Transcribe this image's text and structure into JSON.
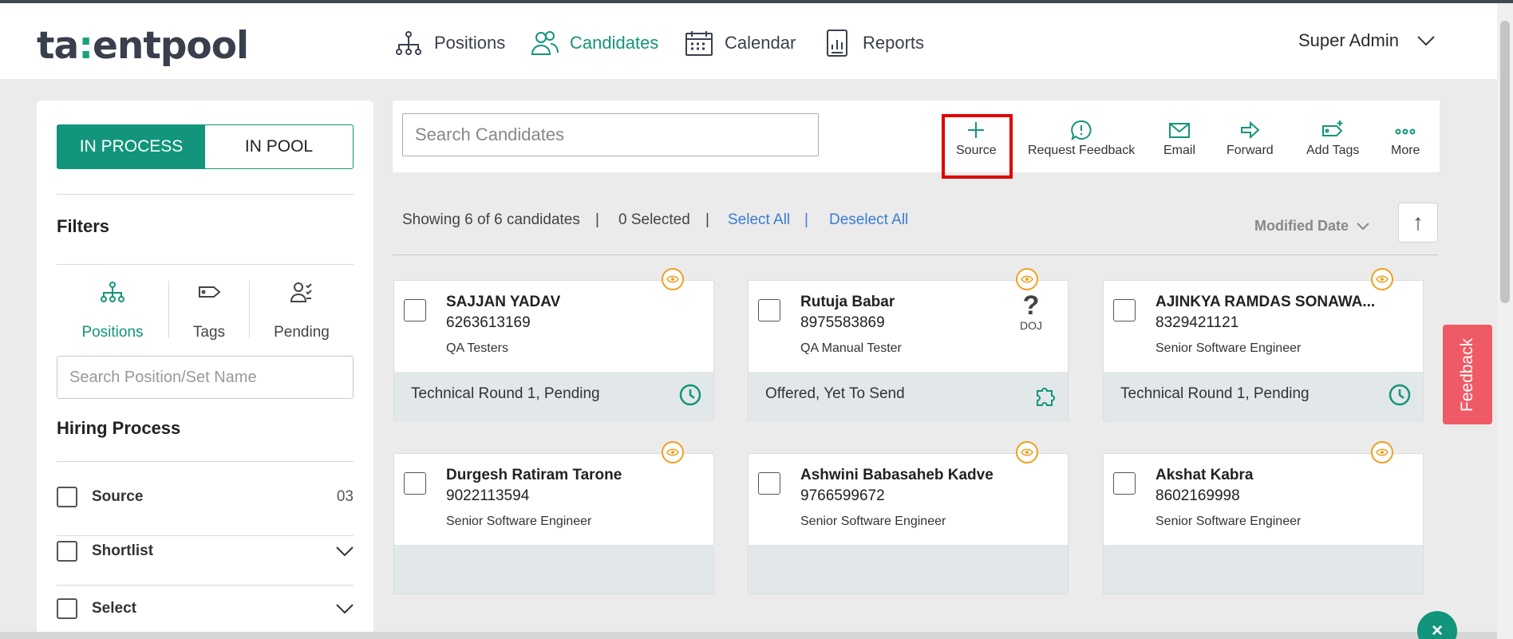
{
  "app": {
    "logo_pre": "ta",
    "logo_accent": ":",
    "logo_post": "entpool"
  },
  "nav": {
    "positions": "Positions",
    "candidates": "Candidates",
    "calendar": "Calendar",
    "reports": "Reports"
  },
  "user": {
    "name": "Super Admin"
  },
  "sidebar": {
    "toggle_in_process": "IN PROCESS",
    "toggle_in_pool": "IN POOL",
    "filters_title": "Filters",
    "tab_positions": "Positions",
    "tab_tags": "Tags",
    "tab_pending": "Pending",
    "search_placeholder": "Search Position/Set Name",
    "hiring_title": "Hiring Process",
    "process": [
      {
        "label": "Source",
        "count": "03"
      },
      {
        "label": "Shortlist"
      },
      {
        "label": "Select"
      }
    ]
  },
  "toolbar": {
    "search_placeholder": "Search Candidates",
    "source": "Source",
    "request_feedback": "Request Feedback",
    "email": "Email",
    "forward": "Forward",
    "add_tags": "Add Tags",
    "more": "More"
  },
  "summary": {
    "showing": "Showing 6 of 6 candidates",
    "separator": "|",
    "selected": "0 Selected",
    "select_all": "Select All",
    "deselect_all": "Deselect All",
    "sort_label": "Modified Date"
  },
  "candidates": [
    {
      "name": "SAJJAN YADAV",
      "phone": "6263613169",
      "role": "QA Testers",
      "status": "Technical Round 1, Pending"
    },
    {
      "name": "Rutuja Babar",
      "phone": "8975583869",
      "role": "QA Manual Tester",
      "status": "Offered, Yet To Send",
      "badge": "DOJ"
    },
    {
      "name": "AJINKYA RAMDAS SONAWA...",
      "phone": "8329421121",
      "role": "Senior Software Engineer",
      "status": "Technical Round 1, Pending"
    },
    {
      "name": "Durgesh Ratiram Tarone",
      "phone": "9022113594",
      "role": "Senior Software Engineer",
      "status": ""
    },
    {
      "name": "Ashwini Babasaheb Kadve",
      "phone": "9766599672",
      "role": "Senior Software Engineer",
      "status": ""
    },
    {
      "name": "Akshat Kabra",
      "phone": "8602169998",
      "role": "Senior Software Engineer",
      "status": ""
    }
  ],
  "widgets": {
    "doj_symbol": "?",
    "feedback": "Feedback",
    "close_symbol": "×",
    "sort_up_symbol": "↑"
  },
  "colors": {
    "brand": "#12957a",
    "highlight": "#e00000",
    "eye": "#f0a020",
    "feedback": "#ee5a65",
    "link": "#3a7bd5"
  }
}
